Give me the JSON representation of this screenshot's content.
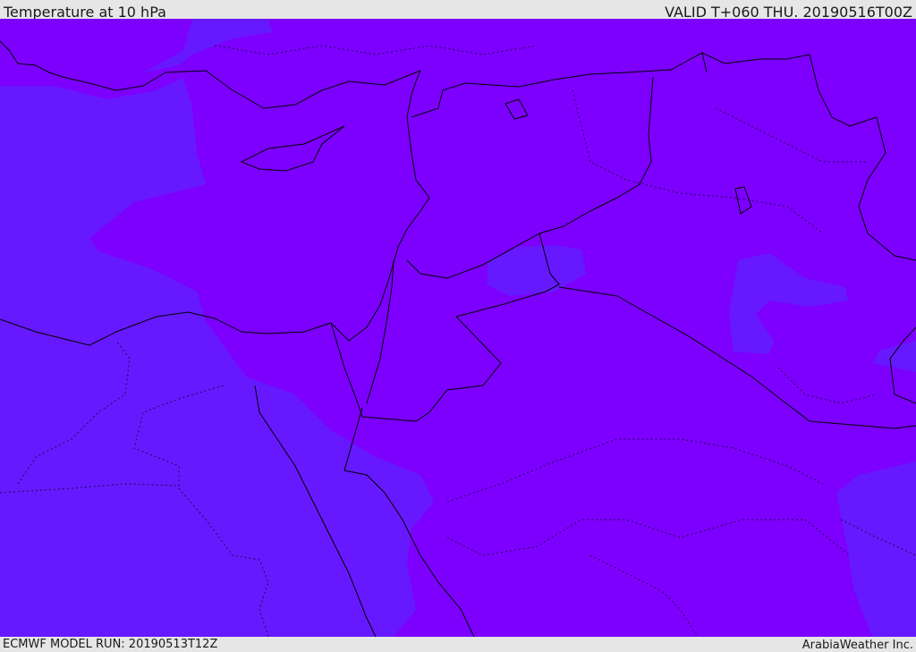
{
  "header": {
    "title": "Temperature at 10 hPa",
    "valid": "VALID T+060 THU. 20190516T00Z"
  },
  "map": {
    "field": "Temperature at 10 hPa",
    "colors": {
      "warmer_fill": "#7d00ff",
      "cooler_fill": "#6619ff",
      "border_line": "#000000"
    }
  },
  "footer": {
    "model_run": "ECMWF MODEL RUN: 20190513T12Z",
    "credit": "ArabiaWeather Inc."
  }
}
